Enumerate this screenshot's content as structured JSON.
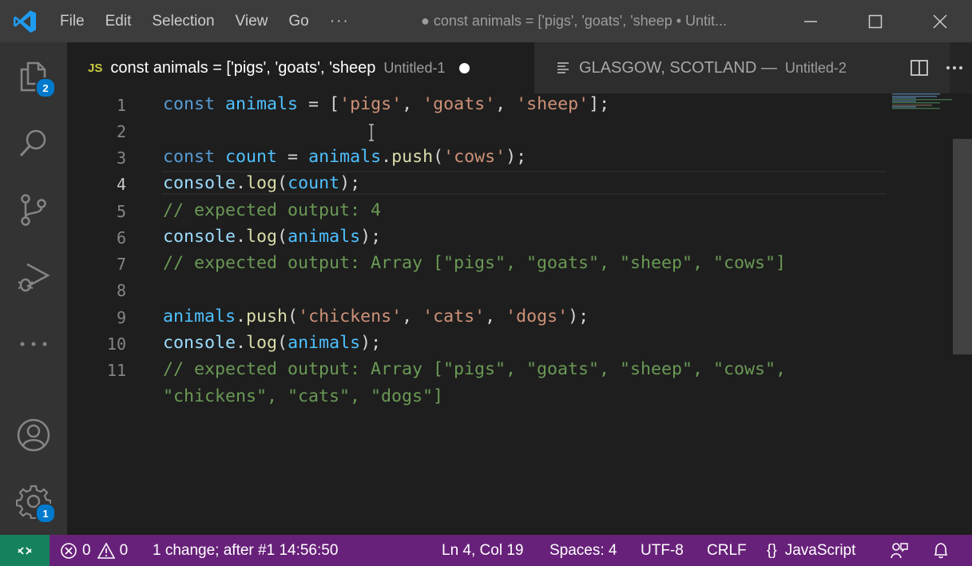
{
  "titlebar": {
    "menu": [
      "File",
      "Edit",
      "Selection",
      "View",
      "Go"
    ],
    "more": "···",
    "window_title": "● const animals = ['pigs', 'goats', 'sheep • Untit..."
  },
  "activitybar": {
    "icons": [
      "explorer-icon",
      "search-icon",
      "source-control-icon",
      "run-debug-icon",
      "more-icon",
      "account-icon",
      "settings-icon"
    ],
    "explorer_badge": "2",
    "settings_badge": "1"
  },
  "tabs": [
    {
      "icon": "JS",
      "name": "const animals = ['pigs', 'goats', 'sheep",
      "description": "Untitled-1",
      "dirty": true
    },
    {
      "icon": "text-file-icon",
      "name": "GLASGOW, SCOTLAND —",
      "description": "Untitled-2"
    }
  ],
  "editor": {
    "line_numbers": [
      "1",
      "2",
      "3",
      "4",
      "5",
      "6",
      "7",
      "8",
      "9",
      "10",
      "11"
    ],
    "current_line": "4",
    "lines": {
      "l1": [
        "const",
        " ",
        "animals",
        " = [",
        "'pigs'",
        ", ",
        "'goats'",
        ", ",
        "'sheep'",
        "];"
      ],
      "l3": [
        "const",
        " ",
        "count",
        " = ",
        "animals",
        ".",
        "push",
        "(",
        "'cows'",
        ");"
      ],
      "l4": [
        "console",
        ".",
        "log",
        "(",
        "count",
        ");"
      ],
      "l5": "// expected output: 4",
      "l6": [
        "console",
        ".",
        "log",
        "(",
        "animals",
        ");"
      ],
      "l7": "// expected output: Array [\"pigs\", \"goats\", \"sheep\", \"cows\"]",
      "l9": [
        "animals",
        ".",
        "push",
        "(",
        "'chickens'",
        ", ",
        "'cats'",
        ", ",
        "'dogs'",
        ");"
      ],
      "l10": [
        "console",
        ".",
        "log",
        "(",
        "animals",
        ");"
      ],
      "l11a": "// expected output: Array [\"pigs\", \"goats\", \"sheep\", \"cows\",",
      "l11b": "\"chickens\", \"cats\", \"dogs\"]"
    }
  },
  "statusbar": {
    "errors": "0",
    "warnings": "0",
    "changes": "1 change; after #1  14:56:50",
    "position": "Ln 4, Col 19",
    "spaces": "Spaces: 4",
    "encoding": "UTF-8",
    "eol": "CRLF",
    "language_icon": "{}",
    "language": "JavaScript"
  },
  "colors": {
    "statusbar_bg": "#68217a",
    "remote_bg": "#16825d",
    "accent": "#007acc"
  }
}
